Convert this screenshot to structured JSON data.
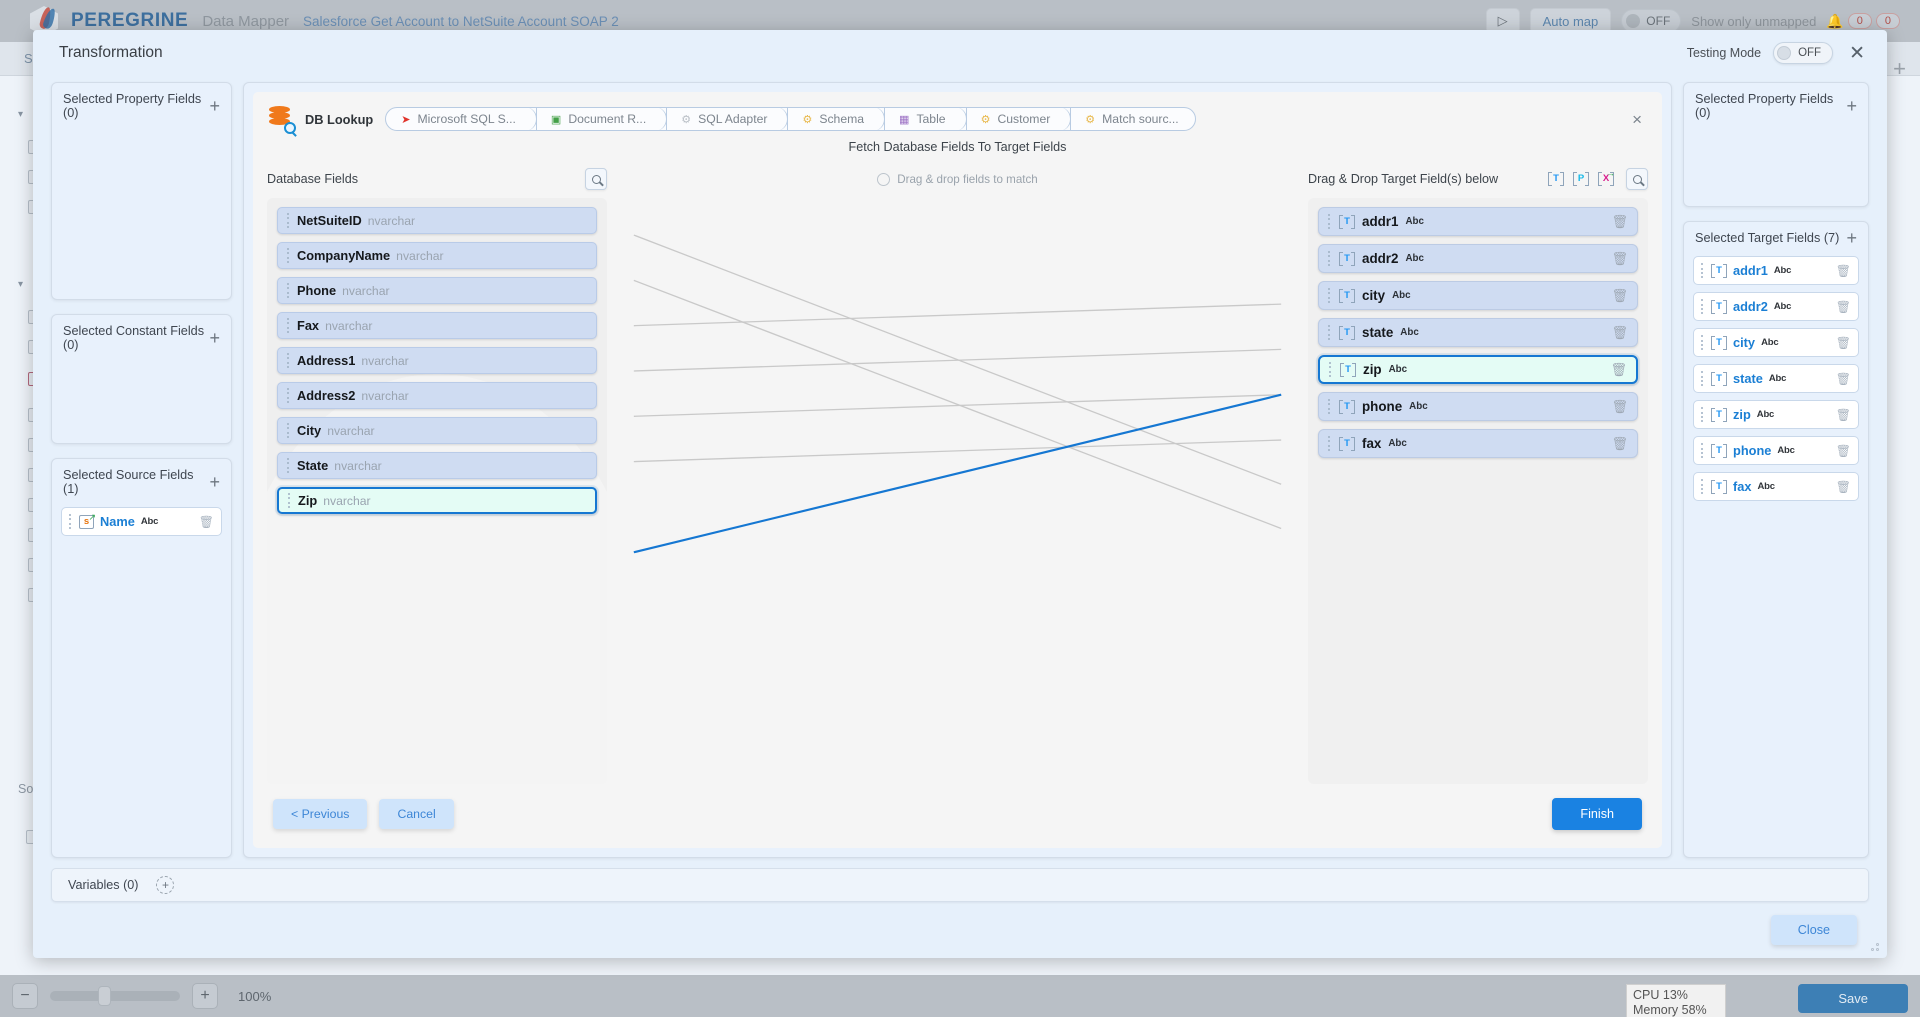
{
  "background": {
    "brand_name": "PEREGRINE",
    "app_name": "Data Mapper",
    "document_name": "Salesforce Get Account to NetSuite Account SOAP 2",
    "play_icon": "play-icon",
    "auto_map_label": "Auto map",
    "unmapped_toggle_state": "OFF",
    "unmapped_label": "Show only unmapped",
    "bell_icon": "bell-icon",
    "badge_left": "0",
    "badge_right": "0",
    "source_label": "Sour",
    "source_label_2": "Sour",
    "zoom": {
      "minus": "−",
      "plus": "+",
      "percent": "100%"
    },
    "status": {
      "cpu": "CPU 13%",
      "memory": "Memory 58%"
    },
    "save_label": "Save"
  },
  "modal": {
    "title": "Transformation",
    "testing_mode_label": "Testing Mode",
    "testing_mode_state": "OFF",
    "close_icon": "close-icon",
    "close_button_label": "Close"
  },
  "left_sidebar": {
    "panels": [
      {
        "title": "Selected Property Fields (0)",
        "add_icon": "plus-icon",
        "items": []
      },
      {
        "title": "Selected Constant Fields (0)",
        "add_icon": "plus-icon",
        "items": []
      },
      {
        "title": "Selected Source Fields (1)",
        "add_icon": "plus-icon",
        "items": [
          {
            "name": "Name",
            "type": "Abc",
            "icon": "source-field-icon",
            "delete_icon": "trash-icon"
          }
        ]
      }
    ]
  },
  "right_sidebar": {
    "panels": [
      {
        "title": "Selected Property Fields (0)",
        "add_icon": "plus-icon",
        "items": []
      },
      {
        "title": "Selected Target Fields (7)",
        "add_icon": "plus-icon",
        "items": [
          {
            "name": "addr1",
            "type": "Abc",
            "icon": "target-field-icon",
            "delete_icon": "trash-icon"
          },
          {
            "name": "addr2",
            "type": "Abc",
            "icon": "target-field-icon",
            "delete_icon": "trash-icon"
          },
          {
            "name": "city",
            "type": "Abc",
            "icon": "target-field-icon",
            "delete_icon": "trash-icon"
          },
          {
            "name": "state",
            "type": "Abc",
            "icon": "target-field-icon",
            "delete_icon": "trash-icon"
          },
          {
            "name": "zip",
            "type": "Abc",
            "icon": "target-field-icon",
            "delete_icon": "trash-icon"
          },
          {
            "name": "phone",
            "type": "Abc",
            "icon": "target-field-icon",
            "delete_icon": "trash-icon"
          },
          {
            "name": "fax",
            "type": "Abc",
            "icon": "target-field-icon",
            "delete_icon": "trash-icon"
          }
        ]
      }
    ]
  },
  "stage": {
    "node_label": "DB Lookup",
    "node_icon": "database-search-icon",
    "breadcrumbs": [
      {
        "label": "Microsoft SQL S...",
        "icon": "sql-server-icon"
      },
      {
        "label": "Document R...",
        "icon": "document-icon"
      },
      {
        "label": "SQL Adapter",
        "icon": "gears-icon"
      },
      {
        "label": "Schema",
        "icon": "gears-icon"
      },
      {
        "label": "Table",
        "icon": "table-icon"
      },
      {
        "label": "Customer",
        "icon": "gears-icon"
      },
      {
        "label": "Match sourc...",
        "icon": "gears-icon"
      }
    ],
    "close_icon": "close-icon",
    "fetch_title": "Fetch Database Fields To Target Fields",
    "database_fields_label": "Database Fields",
    "database_search_icon": "search-icon",
    "drag_hint": "Drag & drop fields to match",
    "target_label": "Drag & Drop Target Field(s) below",
    "target_tool_icons": [
      "text-field-icon",
      "property-field-icon",
      "expression-field-icon"
    ],
    "target_search_icon": "search-icon",
    "database_fields": [
      {
        "name": "NetSuiteID",
        "type": "nvarchar",
        "selected": false
      },
      {
        "name": "CompanyName",
        "type": "nvarchar",
        "selected": false
      },
      {
        "name": "Phone",
        "type": "nvarchar",
        "selected": false
      },
      {
        "name": "Fax",
        "type": "nvarchar",
        "selected": false
      },
      {
        "name": "Address1",
        "type": "nvarchar",
        "selected": false
      },
      {
        "name": "Address2",
        "type": "nvarchar",
        "selected": false
      },
      {
        "name": "City",
        "type": "nvarchar",
        "selected": false
      },
      {
        "name": "State",
        "type": "nvarchar",
        "selected": false
      },
      {
        "name": "Zip",
        "type": "nvarchar",
        "selected": true
      }
    ],
    "target_fields": [
      {
        "name": "addr1",
        "type": "Abc",
        "selected": false,
        "delete_icon": "trash-icon"
      },
      {
        "name": "addr2",
        "type": "Abc",
        "selected": false,
        "delete_icon": "trash-icon"
      },
      {
        "name": "city",
        "type": "Abc",
        "selected": false,
        "delete_icon": "trash-icon"
      },
      {
        "name": "state",
        "type": "Abc",
        "selected": false,
        "delete_icon": "trash-icon"
      },
      {
        "name": "zip",
        "type": "Abc",
        "selected": true,
        "delete_icon": "trash-icon"
      },
      {
        "name": "phone",
        "type": "Abc",
        "selected": false,
        "delete_icon": "trash-icon"
      },
      {
        "name": "fax",
        "type": "Abc",
        "selected": false,
        "delete_icon": "trash-icon"
      }
    ],
    "buttons": {
      "previous": "< Previous",
      "cancel": "Cancel",
      "finish": "Finish"
    }
  },
  "variables": {
    "label": "Variables (0)",
    "add_icon": "plus-icon"
  },
  "colors": {
    "accent_blue": "#1a82e2",
    "chip_blue": "#cfdcf2",
    "selected_mint": "#e4fcf5",
    "selected_border": "#1577d2",
    "panel_bg": "#e8f1fc",
    "modal_bg": "#e6f0fb"
  }
}
